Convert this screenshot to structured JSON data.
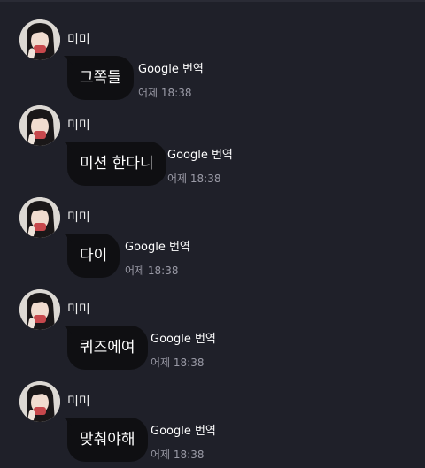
{
  "messages": [
    {
      "sender": "미미",
      "text": "그쪽들",
      "translate_label": "Google 번역",
      "time": "어제 18:38"
    },
    {
      "sender": "미미",
      "text": "미션 한다니",
      "translate_label": "Google 번역",
      "time": "어제 18:38"
    },
    {
      "sender": "미미",
      "text": "다이",
      "translate_label": "Google 번역",
      "time": "어제 18:38"
    },
    {
      "sender": "미미",
      "text": "퀴즈에여",
      "translate_label": "Google 번역",
      "time": "어제 18:38"
    },
    {
      "sender": "미미",
      "text": "맞춰야해",
      "translate_label": "Google 번역",
      "time": "어제 18:38"
    }
  ],
  "colors": {
    "background": "#1f2029",
    "bubble": "#0f0f12",
    "text": "#ffffff",
    "timestamp": "#9a9aa6"
  },
  "icons": {
    "avatar": "profile-photo"
  }
}
